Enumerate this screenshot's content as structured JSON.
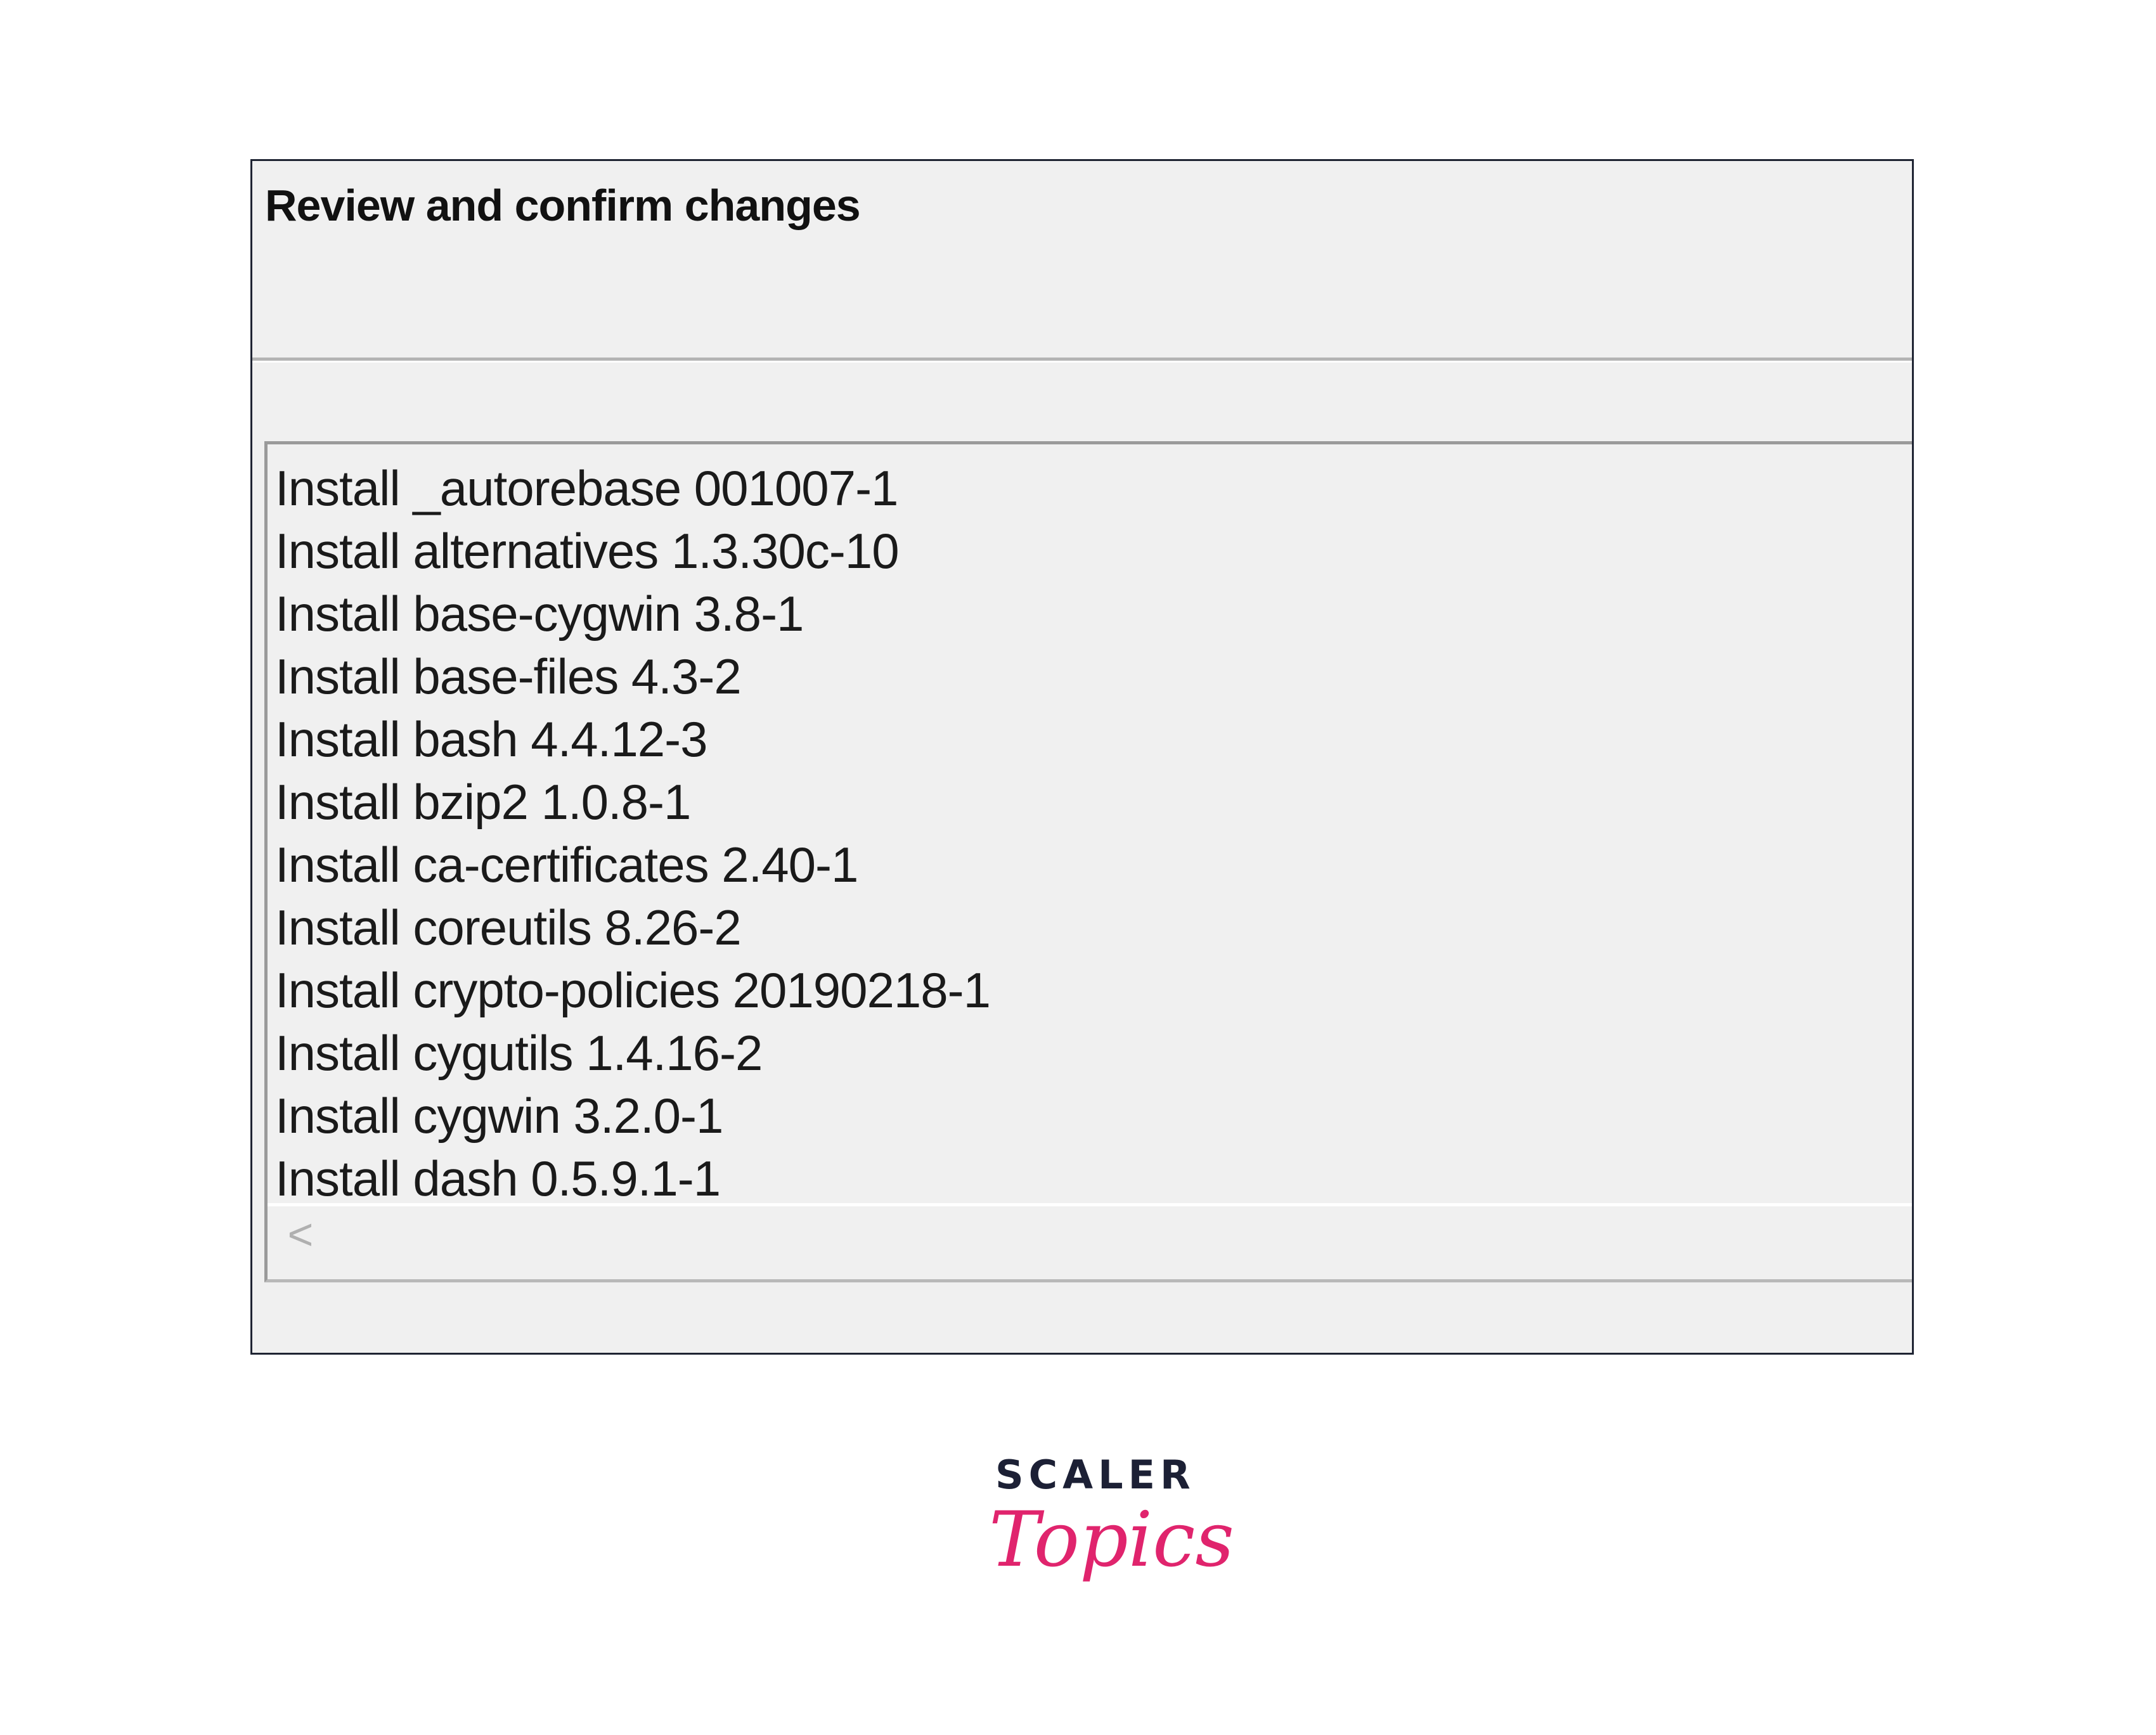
{
  "dialog": {
    "title": "Review and confirm changes"
  },
  "changes": {
    "items": [
      "Install _autorebase 001007-1",
      "Install alternatives 1.3.30c-10",
      "Install base-cygwin 3.8-1",
      "Install base-files 4.3-2",
      "Install bash 4.4.12-3",
      "Install bzip2 1.0.8-1",
      "Install ca-certificates 2.40-1",
      "Install coreutils 8.26-2",
      "Install crypto-policies 20190218-1",
      "Install cygutils 1.4.16-2",
      "Install cygwin 3.2.0-1",
      "Install dash 0.5.9.1-1"
    ]
  },
  "scrollbar": {
    "left_arrow": "<",
    "left_arrow_icon": "chevron-left-icon"
  },
  "branding": {
    "line1": "SCALER",
    "line2": "Topics",
    "accent_color": "#e0246d",
    "dark_color": "#1c2035"
  }
}
